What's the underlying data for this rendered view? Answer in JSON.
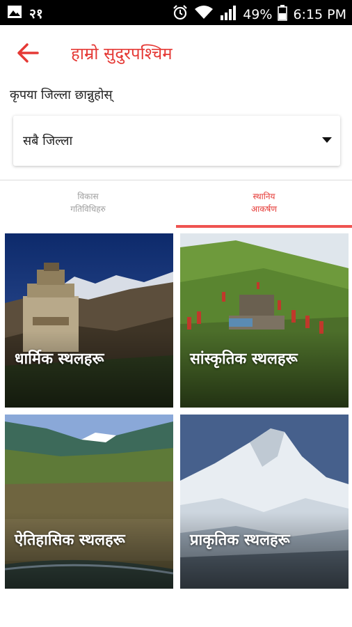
{
  "status_bar": {
    "carrier_number": "२१",
    "battery_percent": "49%",
    "time": "6:15 PM",
    "icons": [
      "image-icon",
      "alarm-icon",
      "wifi-icon",
      "signal-icon",
      "battery-icon"
    ]
  },
  "app_bar": {
    "title": "हाम्रो सुदुरपश्चिम",
    "back_icon": "arrow-left-icon",
    "accent_color": "#e53935"
  },
  "district": {
    "prompt": "कृपया जिल्ला छान्नुहोस्",
    "selected": "सबै जिल्ला"
  },
  "tabs": [
    {
      "line1": "विकास",
      "line2": "गतिविधिहरु",
      "active": false
    },
    {
      "line1": "स्थानिय",
      "line2": "आकर्षण",
      "active": true
    }
  ],
  "cards": [
    {
      "label": "धार्मिक स्थलहरू"
    },
    {
      "label": "सांस्कृतिक स्थलहरू"
    },
    {
      "label": "ऐतिहासिक स्थलहरू"
    },
    {
      "label": "प्राकृतिक स्थलहरू"
    }
  ]
}
